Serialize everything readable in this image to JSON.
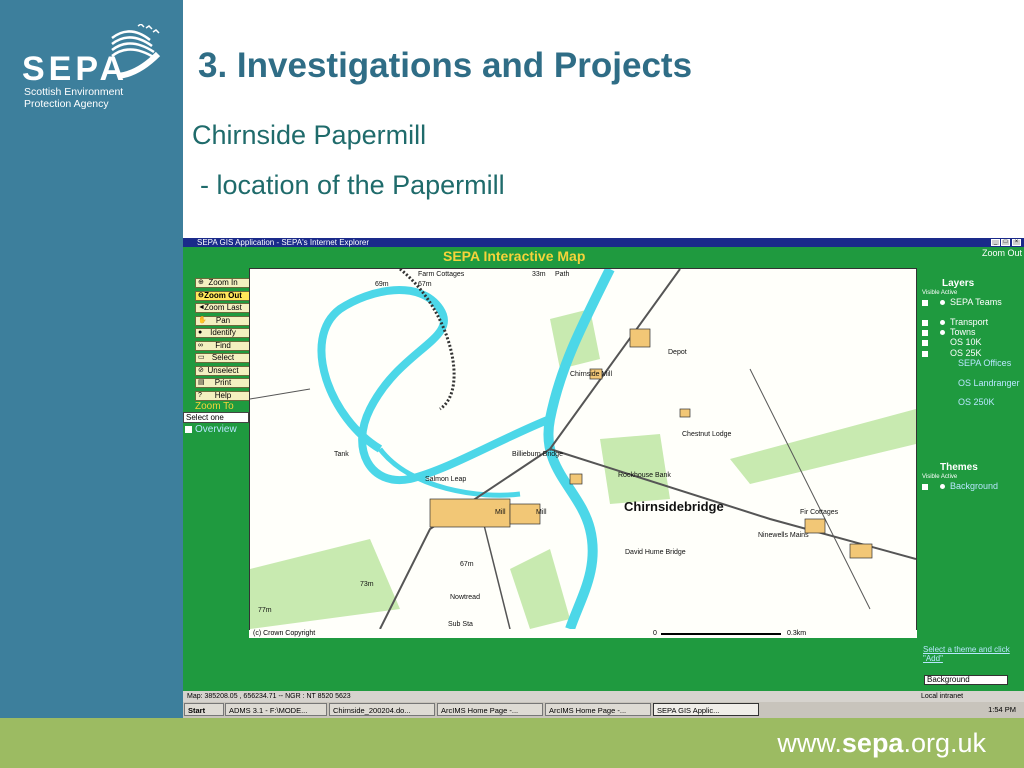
{
  "slide": {
    "brand": {
      "wordmark": "SEPA",
      "tagline1": "Scottish Environment",
      "tagline2": "Protection Agency",
      "color": "#3d7f9c"
    },
    "title": "3.  Investigations and Projects",
    "subtitle": "Chirnside Papermill",
    "subtitle2": "- location of the Papermill",
    "footer": {
      "pre": "www.",
      "brand": "sepa",
      "post": ".org.uk",
      "color": "#9cbb62"
    }
  },
  "screenshot": {
    "window_title": "SEPA GIS Application - SEPA's Internet Explorer",
    "app_title": "SEPA Interactive Map",
    "zoom_out_top": "Zoom Out",
    "window_buttons": [
      "_",
      "□",
      "×"
    ],
    "toolbar": [
      {
        "label": "Zoom In",
        "icon": "zoom-in-icon"
      },
      {
        "label": "Zoom Out",
        "icon": "zoom-out-icon",
        "active": true
      },
      {
        "label": "Zoom Last",
        "icon": "back-arrow-icon"
      },
      {
        "label": "Pan",
        "icon": "hand-icon"
      },
      {
        "label": "Identify",
        "icon": "info-icon"
      },
      {
        "label": "Find",
        "icon": "binoculars-icon"
      },
      {
        "label": "Select",
        "icon": "select-icon"
      },
      {
        "label": "Unselect",
        "icon": "unselect-icon"
      },
      {
        "label": "Print",
        "icon": "printer-icon"
      },
      {
        "label": "Help",
        "icon": "help-icon"
      }
    ],
    "zoom_to_label": "Zoom To",
    "zoom_to_select": "Select one",
    "overview_label": "Overview",
    "layers": {
      "heading": "Layers",
      "visible_active": "Visible Active",
      "items": [
        {
          "name": "SEPA Teams",
          "visible": true,
          "active_enabled": true
        },
        {
          "name": "Transport",
          "visible": false,
          "active_enabled": true
        },
        {
          "name": "Towns",
          "visible": false,
          "active_enabled": true
        },
        {
          "name": "OS 10K",
          "visible": true,
          "active_enabled": false
        },
        {
          "name": "OS 25K",
          "visible": false,
          "active_enabled": false
        },
        {
          "name": "SEPA Offices",
          "inactive": true
        },
        {
          "name": "OS Landranger",
          "inactive": true
        },
        {
          "name": "OS 250K",
          "inactive": true
        }
      ]
    },
    "themes": {
      "heading": "Themes",
      "visible_active": "Visible Active",
      "items": [
        {
          "name": "Background",
          "visible": false
        }
      ]
    },
    "theme_hint": "Select a theme and click \"Add\"",
    "background_select": "Background",
    "map": {
      "labels": [
        "Farm Cottages",
        "33m",
        "Path",
        "67m",
        "69m",
        "Depot",
        "Chirnside Mill",
        "Chestnut Lodge",
        "Tank",
        "Billieburn Bridge",
        "Salmon Leap",
        "Rockhouse Bank",
        "Chirnsidebridge",
        "Fir Cottages",
        "Mill",
        "Mill",
        "Ninewells Mains",
        "David Hume Bridge",
        "67m",
        "73m",
        "Nowtread",
        "77m",
        "Sub Sta",
        "0",
        "0.3km"
      ],
      "copyright": "(c) Crown Copyright"
    },
    "status_text": "Map: 385208.05 , 656234.71 -- NGR : NT 8520 5623",
    "status_zone": "Local intranet",
    "taskbar": [
      "Start",
      "ADMS 3.1 - F:\\MODE...",
      "Chirnside_200204.do...",
      "ArcIMS Home Page -...",
      "ArcIMS Home Page -...",
      "SEPA GIS Applic..."
    ],
    "clock": "1:54 PM"
  }
}
